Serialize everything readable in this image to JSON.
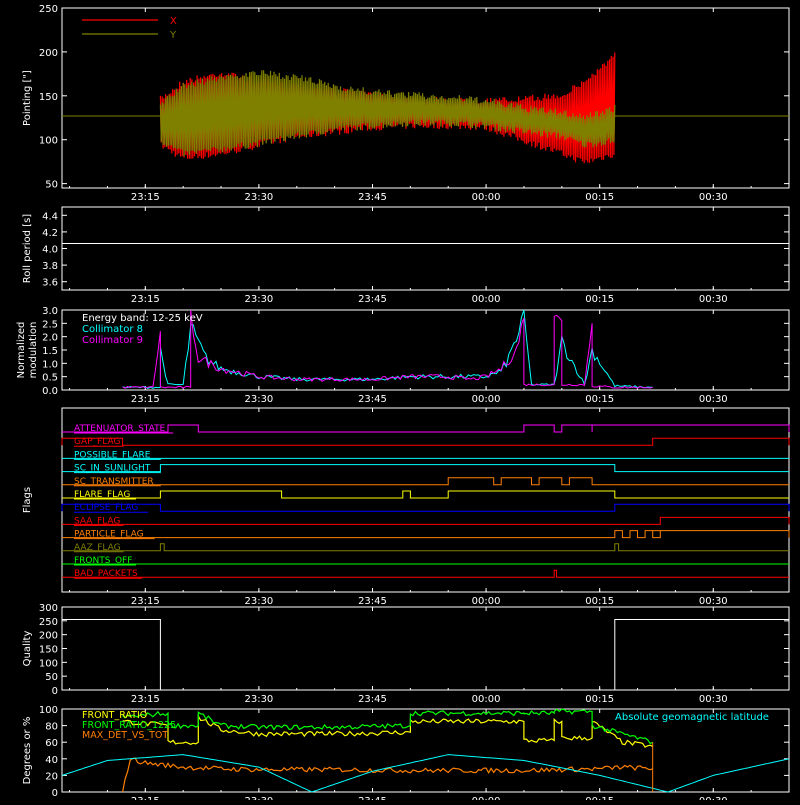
{
  "time_axis": {
    "tick_labels": [
      "23:15",
      "23:30",
      "23:45",
      "00:00",
      "00:15",
      "00:30"
    ]
  },
  "chart_data": [
    {
      "id": "pointing",
      "type": "line",
      "ylabel": "Pointing [\"]",
      "ylim": [
        45,
        250
      ],
      "yticks": [
        50,
        100,
        150,
        200,
        250
      ],
      "legend": {
        "placement": "top-left",
        "entries": [
          {
            "label": "X",
            "color": "#ff0000"
          },
          {
            "label": "Y",
            "color": "#808000"
          }
        ]
      },
      "reference_line": 127,
      "series": [
        {
          "name": "X",
          "color": "#ff0000",
          "envelope": {
            "x": [
              "23:17",
              "23:20",
              "23:25",
              "23:30",
              "23:35",
              "23:40",
              "23:45",
              "23:50",
              "23:55",
              "00:00",
              "00:05",
              "00:10",
              "00:13",
              "00:17"
            ],
            "upper": [
              150,
              170,
              180,
              170,
              165,
              160,
              155,
              150,
              148,
              148,
              150,
              155,
              170,
              200
            ],
            "lower": [
              90,
              75,
              80,
              90,
              100,
              105,
              110,
              112,
              112,
              110,
              95,
              80,
              70,
              80
            ]
          }
        },
        {
          "name": "Y",
          "color": "#808000",
          "envelope": {
            "x": [
              "23:17",
              "23:20",
              "23:25",
              "23:30",
              "23:35",
              "23:40",
              "23:45",
              "23:50",
              "23:55",
              "00:00",
              "00:05",
              "00:10",
              "00:13",
              "00:17"
            ],
            "upper": [
              145,
              165,
              175,
              180,
              175,
              165,
              158,
              155,
              152,
              148,
              140,
              135,
              130,
              140
            ],
            "lower": [
              95,
              80,
              85,
              92,
              100,
              108,
              112,
              115,
              115,
              112,
              105,
              100,
              90,
              95
            ]
          }
        }
      ]
    },
    {
      "id": "roll_period",
      "type": "line",
      "ylabel": "Roll period [s]",
      "ylim": [
        3.5,
        4.5
      ],
      "yticks": [
        3.6,
        3.8,
        4.0,
        4.2,
        4.4
      ],
      "series": [
        {
          "name": "",
          "color": "#ffffff",
          "x": [
            "23:04",
            "00:40"
          ],
          "y": [
            4.06,
            4.06
          ]
        }
      ]
    },
    {
      "id": "modulation",
      "type": "line",
      "ylabel": "Normalized modulation",
      "ylim": [
        0,
        3.0
      ],
      "yticks": [
        0.0,
        0.5,
        1.0,
        1.5,
        2.0,
        2.5,
        3.0
      ],
      "legend": {
        "placement": "top-left",
        "entries": [
          {
            "label": "Energy band: 12-25 keV",
            "color": "#ffffff"
          },
          {
            "label": "Collimator 8",
            "color": "#00ffff"
          },
          {
            "label": "Collimator 9",
            "color": "#ff00ff"
          }
        ]
      },
      "series": [
        {
          "name": "Collimator 8",
          "color": "#00ffff",
          "x": [
            "23:12",
            "23:17",
            "23:17",
            "23:18",
            "23:20",
            "23:21",
            "23:23",
            "23:25",
            "23:30",
            "23:35",
            "23:40",
            "23:45",
            "23:50",
            "23:55",
            "23:58",
            "00:00",
            "00:02",
            "00:03",
            "00:05",
            "00:06",
            "00:09",
            "00:10",
            "00:13",
            "00:14",
            "00:17",
            "00:22"
          ],
          "y": [
            0.1,
            0.1,
            1.5,
            0.2,
            0.2,
            2.3,
            1.2,
            0.8,
            0.5,
            0.4,
            0.4,
            0.4,
            0.5,
            0.5,
            0.5,
            0.5,
            0.7,
            1.2,
            2.7,
            0.2,
            0.2,
            1.8,
            0.2,
            1.5,
            0.15,
            0.1
          ]
        },
        {
          "name": "Collimator 9",
          "color": "#ff00ff",
          "x": [
            "23:12",
            "23:16",
            "23:17",
            "23:17",
            "23:18",
            "23:21",
            "23:21",
            "23:22",
            "23:25",
            "23:30",
            "23:35",
            "23:40",
            "23:45",
            "23:50",
            "23:55",
            "23:58",
            "00:00",
            "00:02",
            "00:04",
            "00:05",
            "00:05",
            "00:06",
            "00:09",
            "00:09",
            "00:10",
            "00:10",
            "00:13",
            "00:14",
            "00:14",
            "00:17",
            "00:22"
          ],
          "y": [
            0.1,
            0.1,
            2.2,
            0.1,
            0.1,
            0.1,
            2.9,
            1.2,
            0.8,
            0.5,
            0.4,
            0.4,
            0.4,
            0.5,
            0.5,
            0.4,
            0.5,
            0.8,
            1.5,
            2.7,
            0.2,
            0.2,
            0.2,
            2.6,
            2.6,
            0.2,
            0.2,
            2.5,
            0.15,
            0.1,
            0.1
          ]
        }
      ]
    },
    {
      "id": "flags",
      "type": "line",
      "ylabel": "Flags",
      "flags": [
        {
          "name": "ATTENUATOR_STATE",
          "color": "#ff00ff",
          "high": [
            [
              "23:18",
              "23:22"
            ],
            [
              "00:05",
              "00:09"
            ],
            [
              "00:10",
              "00:14"
            ],
            [
              "00:14",
              "00:40"
            ]
          ]
        },
        {
          "name": "GAP_FLAG",
          "color": "#ff0000",
          "high": [
            [
              "23:04",
              "23:12"
            ],
            [
              "00:22",
              "00:40"
            ]
          ]
        },
        {
          "name": "POSSIBLE_FLARE",
          "color": "#00ffff",
          "high": []
        },
        {
          "name": "SC_IN_SUNLIGHT",
          "color": "#00ffff",
          "high": [
            [
              "23:17",
              "00:17"
            ]
          ]
        },
        {
          "name": "SC_TRANSMITTER",
          "color": "#ff8000",
          "high": [
            [
              "23:55",
              "00:01"
            ],
            [
              "00:02",
              "00:06"
            ],
            [
              "00:07",
              "00:10"
            ],
            [
              "00:11",
              "00:14"
            ]
          ]
        },
        {
          "name": "FLARE_FLAG",
          "color": "#ffff00",
          "high": [
            [
              "23:17",
              "23:33"
            ],
            [
              "23:49",
              "23:50"
            ],
            [
              "23:55",
              "00:17"
            ]
          ]
        },
        {
          "name": "ECLIPSE_FLAG",
          "color": "#0000ff",
          "high": [
            [
              "23:04",
              "23:17"
            ],
            [
              "00:17",
              "00:40"
            ]
          ]
        },
        {
          "name": "SAA_FLAG",
          "color": "#ff0000",
          "high": [
            [
              "00:23",
              "00:40"
            ]
          ]
        },
        {
          "name": "PARTICLE_FLAG",
          "color": "#ff8000",
          "high": [
            [
              "00:17",
              "00:18"
            ],
            [
              "00:19",
              "00:20"
            ],
            [
              "00:21",
              "00:23"
            ],
            [
              "00:22",
              "00:40"
            ]
          ]
        },
        {
          "name": "AAZ_FLAG",
          "color": "#808000",
          "high": [
            [
              "23:17",
              "23:17.5"
            ],
            [
              "00:17",
              "00:17.5"
            ]
          ]
        },
        {
          "name": "FRONTS_OFF",
          "color": "#00ff00",
          "high": []
        },
        {
          "name": "BAD_PACKETS",
          "color": "#ff0000",
          "high": [
            [
              "00:09",
              "00:09.3"
            ]
          ]
        }
      ]
    },
    {
      "id": "quality",
      "type": "line",
      "ylabel": "Quality",
      "ylim": [
        0,
        300
      ],
      "yticks": [
        0,
        50,
        100,
        150,
        200,
        250,
        300
      ],
      "series": [
        {
          "name": "",
          "color": "#ffffff",
          "x": [
            "23:04",
            "23:17",
            "23:17",
            "00:16",
            "00:17",
            "00:17",
            "00:40"
          ],
          "y": [
            255,
            255,
            0,
            0,
            0,
            255,
            255
          ]
        }
      ]
    },
    {
      "id": "ratios",
      "type": "line",
      "ylabel": "Degrees or %",
      "ylim": [
        0,
        100
      ],
      "yticks": [
        0,
        20,
        40,
        60,
        80,
        100
      ],
      "legend": {
        "placement": "top-left",
        "entries": [
          {
            "label": "FRONT_RATIO",
            "color": "#ffff00"
          },
          {
            "label": "FRONT_RATIO_1225",
            "color": "#00ff00"
          },
          {
            "label": "MAX_DET_VS_TOT",
            "color": "#ff8000"
          }
        ],
        "extra": {
          "label": "Absolute geomagnetic latitude",
          "color": "#00ffff"
        }
      },
      "series": [
        {
          "name": "FRONT_RATIO",
          "color": "#ffff00",
          "x": [
            "23:12",
            "23:18",
            "23:18",
            "23:22",
            "23:22",
            "23:25",
            "23:30",
            "23:40",
            "23:50",
            "23:50",
            "00:00",
            "00:05",
            "00:05",
            "00:09",
            "00:09",
            "00:10",
            "00:10",
            "00:14",
            "00:14",
            "00:18",
            "00:22"
          ],
          "y": [
            85,
            80,
            60,
            60,
            90,
            75,
            70,
            70,
            72,
            85,
            85,
            85,
            62,
            62,
            85,
            85,
            65,
            65,
            85,
            60,
            55
          ]
        },
        {
          "name": "FRONT_RATIO_1225",
          "color": "#00ff00",
          "x": [
            "23:12",
            "23:18",
            "23:18",
            "23:22",
            "23:22",
            "23:25",
            "23:30",
            "23:40",
            "23:50",
            "23:50",
            "00:00",
            "00:05",
            "00:05",
            "00:09",
            "00:09",
            "00:14",
            "00:14",
            "00:18",
            "00:22"
          ],
          "y": [
            90,
            95,
            80,
            80,
            95,
            80,
            78,
            78,
            80,
            95,
            95,
            95,
            95,
            95,
            97,
            97,
            80,
            70,
            60
          ]
        },
        {
          "name": "MAX_DET_VS_TOT",
          "color": "#ff8000",
          "x": [
            "23:12",
            "23:13",
            "23:15",
            "23:20",
            "23:25",
            "23:30",
            "23:40",
            "23:50",
            "00:00",
            "00:05",
            "00:10",
            "00:15",
            "00:18",
            "00:22"
          ],
          "y": [
            0,
            40,
            35,
            30,
            28,
            27,
            27,
            26,
            26,
            26,
            27,
            28,
            30,
            28
          ]
        },
        {
          "name": "Absolute geomagnetic latitude",
          "color": "#00ffff",
          "x": [
            "23:04",
            "23:10",
            "23:20",
            "23:30",
            "23:37",
            "23:45",
            "23:55",
            "00:05",
            "00:15",
            "00:24",
            "00:30",
            "00:40"
          ],
          "y": [
            20,
            38,
            45,
            30,
            0,
            25,
            45,
            38,
            20,
            0,
            20,
            40
          ]
        }
      ]
    }
  ]
}
